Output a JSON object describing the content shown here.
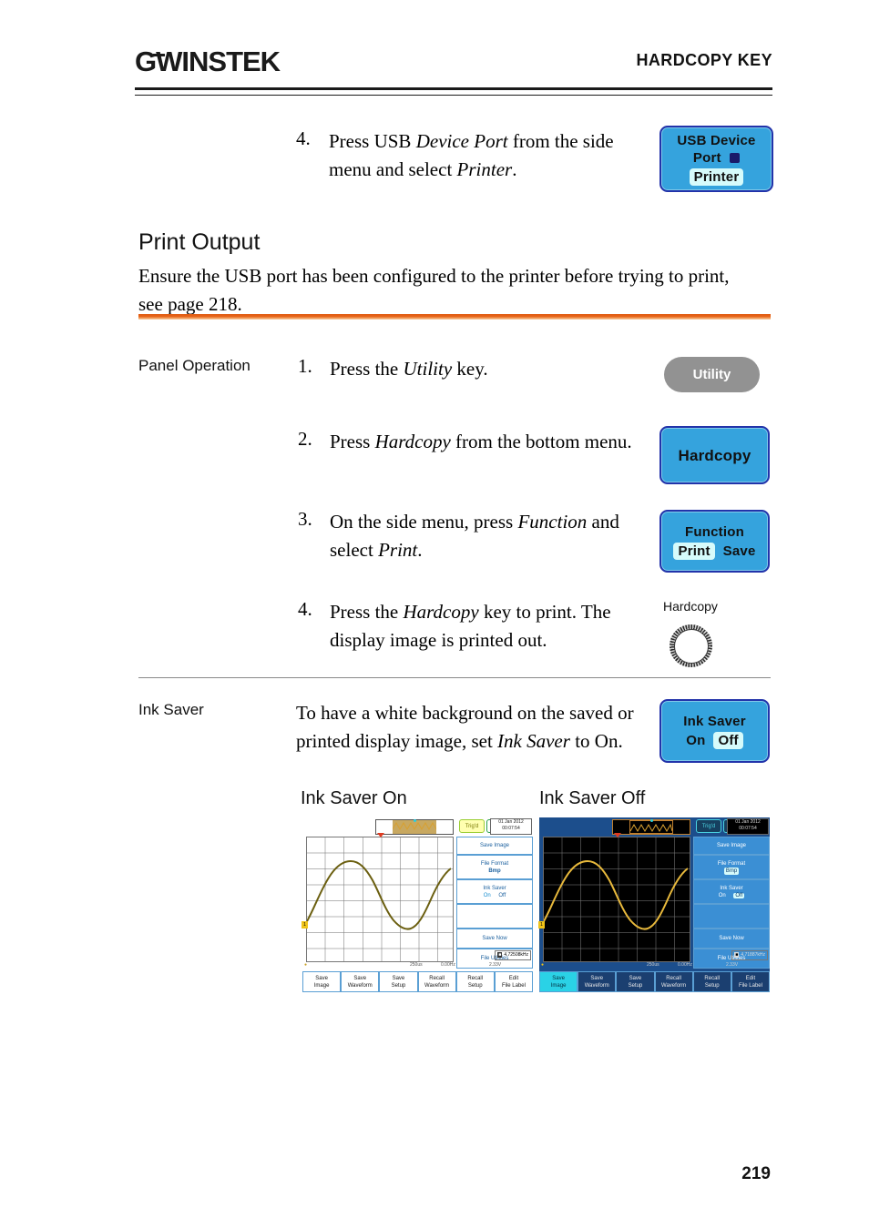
{
  "header": {
    "logo_gw": "G",
    "logo_w": "W",
    "logo_instek": "INSTEK",
    "title": "HARDCOPY KEY"
  },
  "step_top": {
    "number": "4.",
    "text_a": "Press USB ",
    "text_b": "Device Port",
    "text_c": " from the side menu and select ",
    "text_d": "Printer",
    "text_e": "."
  },
  "usb_key": {
    "line1": "USB Device",
    "line2": "Port",
    "value": "Printer"
  },
  "section": {
    "heading": "Print Output",
    "body": "Ensure the USB port has been configured to the printer before trying to print, see page 218."
  },
  "panel_operation": {
    "label": "Panel Operation",
    "steps": [
      {
        "number": "1.",
        "a": "Press the ",
        "b": "Utility",
        "c": " key."
      },
      {
        "number": "2.",
        "a": "Press ",
        "b": "Hardcopy",
        "c": " from the bottom menu."
      },
      {
        "number": "3.",
        "a": "On the side menu, press ",
        "b": "Function",
        "c": " and select ",
        "d": "Print",
        "e": "."
      },
      {
        "number": "4.",
        "a": "Press the ",
        "b": "Hardcopy",
        "c": " key to print. The display image is printed out."
      }
    ]
  },
  "keys": {
    "utility": "Utility",
    "hardcopy": "Hardcopy",
    "function_title": "Function",
    "function_opt_on": "Print",
    "function_opt_off": "Save",
    "hardcopy_knob_label": "Hardcopy",
    "ink_saver_title": "Ink Saver",
    "ink_saver_on": "On",
    "ink_saver_off": "Off"
  },
  "ink_saver": {
    "label": "Ink Saver",
    "a": "To have a white background on the saved or printed display image, set ",
    "b": "Ink Saver",
    "c": " to On.",
    "caption_on": "Ink Saver On",
    "caption_off": "Ink Saver Off"
  },
  "scope": {
    "clock_date": "01 Jan 2012",
    "clock_time": "00:07:54",
    "trigd": "Trig'd",
    "side_menu": [
      {
        "title": "Save Image",
        "value": ""
      },
      {
        "title": "File Format",
        "value": "Bmp"
      },
      {
        "title": "Ink Saver",
        "opt_on": "On",
        "opt_off": "Off"
      },
      {
        "title": "",
        "value": ""
      },
      {
        "title": "Save Now",
        "value": ""
      },
      {
        "title": "File Utilities",
        "value": ""
      }
    ],
    "bottom_menu": [
      {
        "l1": "Save",
        "l2": "Image"
      },
      {
        "l1": "Save",
        "l2": "Waveform"
      },
      {
        "l1": "Save",
        "l2": "Setup"
      },
      {
        "l1": "Recall",
        "l2": "Waveform"
      },
      {
        "l1": "Recall",
        "l2": "Setup"
      },
      {
        "l1": "Edit",
        "l2": "File Label"
      }
    ],
    "status_timebase": "250us",
    "status_sample": "0.00Hz",
    "status_trig": "2.33V",
    "freq_light": "4.72508kHz",
    "freq_dark": "4.71887kHz",
    "ch_marker": "1"
  },
  "colors": {
    "key_blue": "#35a3dd",
    "key_border": "#2233aa",
    "highlight": "#d6fbfb",
    "orange_rule": "#e05a10",
    "waveform_light": "#6b5f10",
    "waveform_dark": "#e8b93c",
    "scope_dark_bg": "#1c4e8c"
  },
  "footer": {
    "page": "219"
  }
}
